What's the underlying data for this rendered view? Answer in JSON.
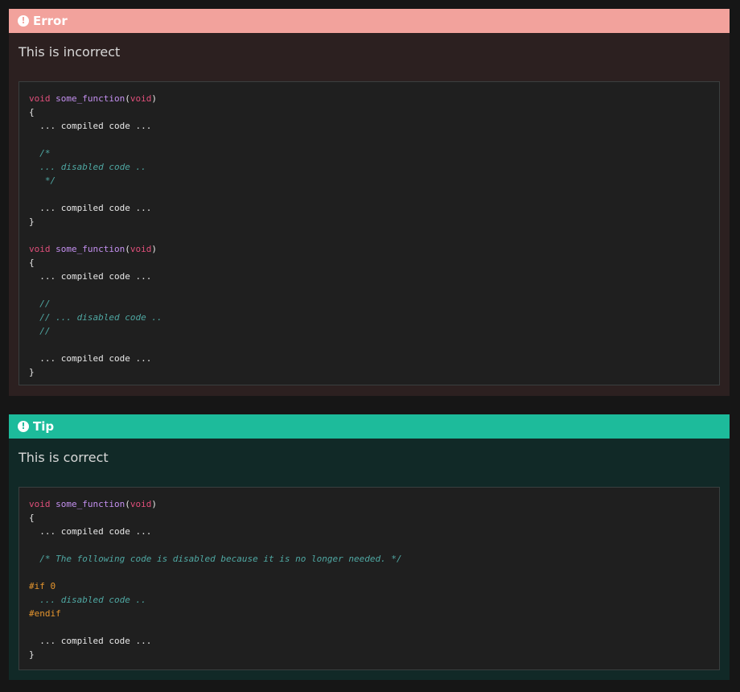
{
  "error": {
    "title": "Error",
    "icon": "exclamation-circle-icon",
    "text": "This is incorrect",
    "accent_color": "#f2a29c",
    "code_lines": [
      [
        {
          "t": "void ",
          "c": "kw"
        },
        {
          "t": "some_function",
          "c": "fn"
        },
        {
          "t": "(",
          "c": "plain"
        },
        {
          "t": "void",
          "c": "kw"
        },
        {
          "t": ")",
          "c": "plain"
        }
      ],
      [
        {
          "t": "{",
          "c": "plain"
        }
      ],
      [
        {
          "t": "  ... compiled code ...",
          "c": "plain"
        }
      ],
      [],
      [
        {
          "t": "  /*",
          "c": "cmt"
        }
      ],
      [
        {
          "t": "  ... disabled code ..",
          "c": "cmt"
        }
      ],
      [
        {
          "t": "   */",
          "c": "cmt"
        }
      ],
      [],
      [
        {
          "t": "  ... compiled code ...",
          "c": "plain"
        }
      ],
      [
        {
          "t": "}",
          "c": "plain"
        }
      ],
      [],
      [
        {
          "t": "void ",
          "c": "kw"
        },
        {
          "t": "some_function",
          "c": "fn"
        },
        {
          "t": "(",
          "c": "plain"
        },
        {
          "t": "void",
          "c": "kw"
        },
        {
          "t": ")",
          "c": "plain"
        }
      ],
      [
        {
          "t": "{",
          "c": "plain"
        }
      ],
      [
        {
          "t": "  ... compiled code ...",
          "c": "plain"
        }
      ],
      [],
      [
        {
          "t": "  //",
          "c": "cmt"
        }
      ],
      [
        {
          "t": "  // ... disabled code ..",
          "c": "cmt"
        }
      ],
      [
        {
          "t": "  //",
          "c": "cmt"
        }
      ],
      [],
      [
        {
          "t": "  ... compiled code ...",
          "c": "plain"
        }
      ],
      [
        {
          "t": "}",
          "c": "plain"
        }
      ]
    ]
  },
  "tip": {
    "title": "Tip",
    "icon": "exclamation-circle-icon",
    "text": "This is correct",
    "accent_color": "#1dbb9b",
    "code_lines": [
      [
        {
          "t": "void ",
          "c": "kw"
        },
        {
          "t": "some_function",
          "c": "fn"
        },
        {
          "t": "(",
          "c": "plain"
        },
        {
          "t": "void",
          "c": "kw"
        },
        {
          "t": ")",
          "c": "plain"
        }
      ],
      [
        {
          "t": "{",
          "c": "plain"
        }
      ],
      [
        {
          "t": "  ... compiled code ...",
          "c": "plain"
        }
      ],
      [],
      [
        {
          "t": "  /* The following code is disabled because it is no longer needed. */",
          "c": "cmt"
        }
      ],
      [],
      [
        {
          "t": "#if 0",
          "c": "pp"
        }
      ],
      [
        {
          "t": "  ... disabled code ..",
          "c": "cmt"
        }
      ],
      [
        {
          "t": "#endif",
          "c": "pp"
        }
      ],
      [],
      [
        {
          "t": "  ... compiled code ...",
          "c": "plain"
        }
      ],
      [
        {
          "t": "}",
          "c": "plain"
        }
      ]
    ]
  }
}
